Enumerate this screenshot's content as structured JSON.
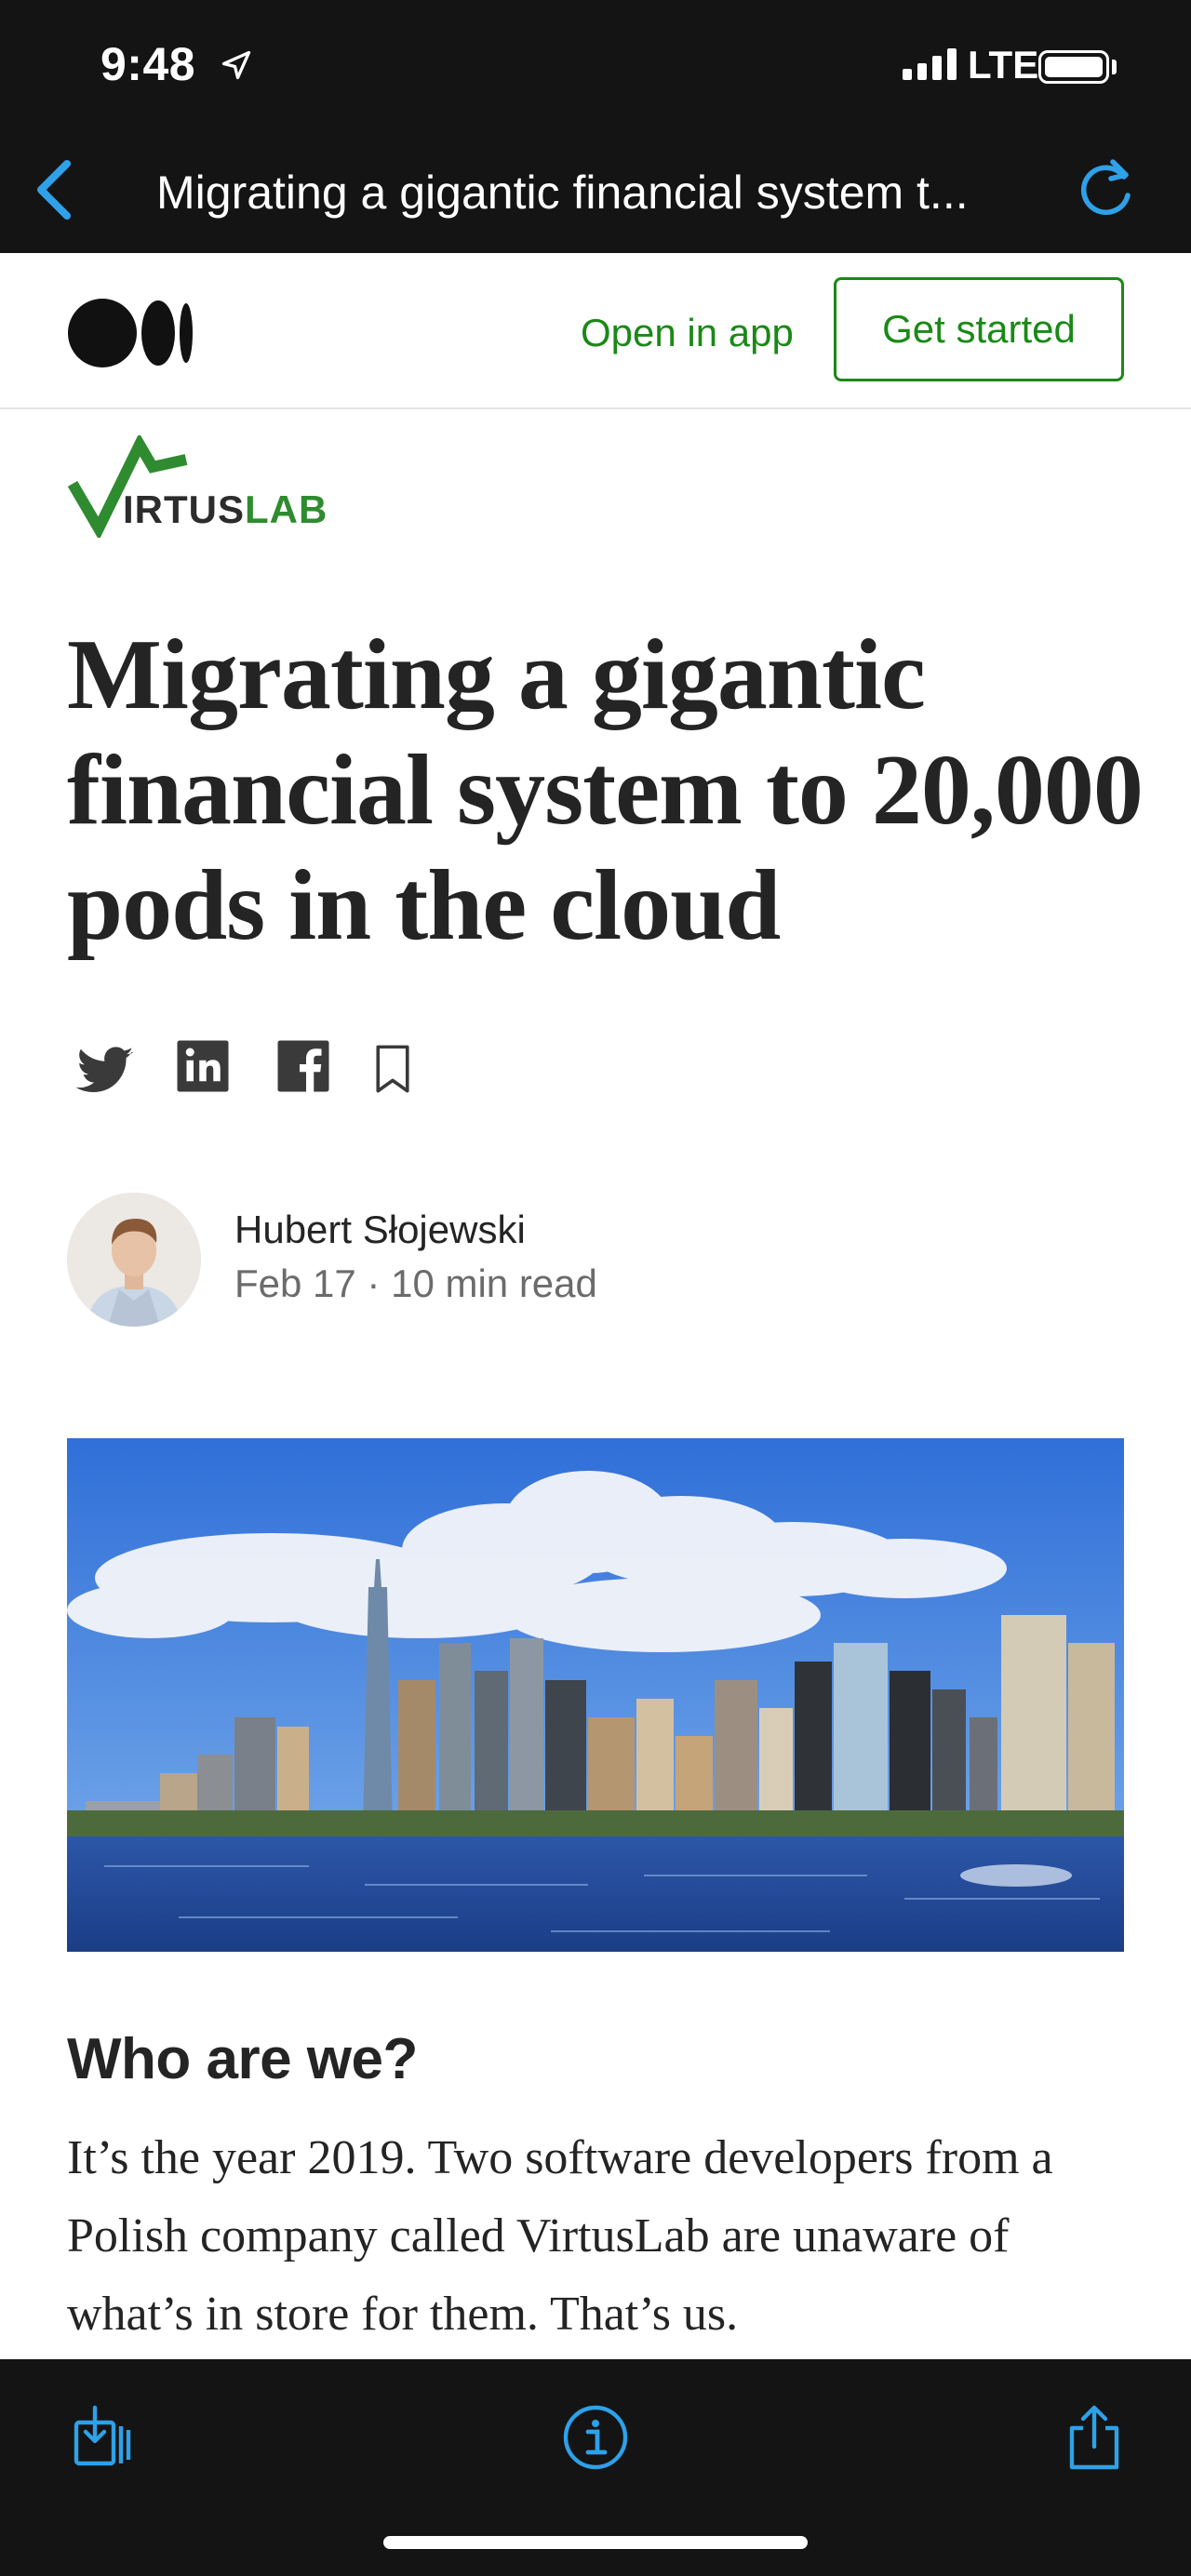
{
  "status_bar": {
    "time": "9:48",
    "network": "LTE",
    "icons": [
      "location-arrow-icon",
      "signal-icon",
      "battery-icon"
    ]
  },
  "nav_bar": {
    "title": "Migrating a gigantic financial system t...",
    "back_icon": "chevron-left-icon",
    "reload_icon": "reload-icon",
    "accent_color": "#2ea1e8"
  },
  "medium_header": {
    "logo_icon": "medium-logo-icon",
    "open_in_app": "Open in app",
    "get_started": "Get started",
    "brand_color": "#1a8917"
  },
  "publication": {
    "logo_text_a": "IRTUS",
    "logo_text_b": "LAB"
  },
  "article": {
    "title": "Migrating a gigantic financial system to 20,000 pods in the cloud",
    "share_icons": [
      "twitter-icon",
      "linkedin-icon",
      "facebook-icon",
      "bookmark-icon"
    ],
    "author": {
      "name": "Hubert Słojewski",
      "meta": "Feb 17 · 10 min read"
    },
    "section_heading": "Who are we?",
    "paragraph": "It’s the year 2019. Two software developers from a Polish company called VirtusLab are unaware of what’s in store for them. That’s us."
  },
  "bottom_toolbar": {
    "icons": [
      "save-download-icon",
      "info-icon",
      "share-icon"
    ]
  }
}
